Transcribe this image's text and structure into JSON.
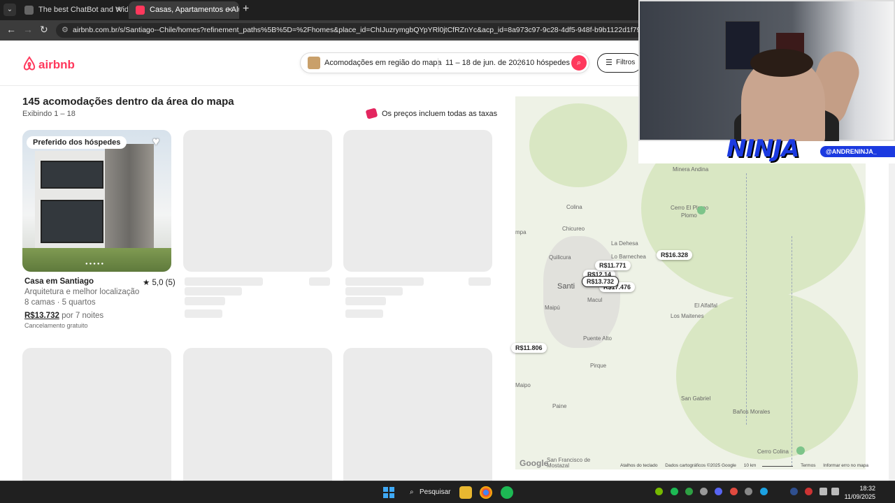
{
  "browser": {
    "tabs": [
      {
        "label": "The best ChatBot and Widgets"
      },
      {
        "label": "Casas, Apartamentos e Aluguéi"
      }
    ],
    "url": "airbnb.com.br/s/Santiago--Chile/homes?refinement_paths%5B%5D=%2Fhomes&place_id=ChIJuzrymgbQYpYRl0jtCfRZnYc&acp_id=8a973c97-9c28-4df5-948f-b9b1122d1f79&date_picker_type=cale"
  },
  "header": {
    "logo": "airbnb",
    "search_location": "Acomodações em região do mapa",
    "search_dates": "11 – 18 de jun. de 2026",
    "search_guests": "10 hóspedes",
    "filters_label": "Filtros"
  },
  "results": {
    "title": "145 acomodações dentro da área do mapa",
    "subtitle": "Exibindo 1 – 18",
    "price_note": "Os preços incluem todas as taxas"
  },
  "listing": {
    "badge": "Preferido dos hóspedes",
    "title": "Casa em Santiago",
    "rating": "★ 5,0 (5)",
    "line1": "Arquitetura e melhor localização",
    "line2": "8 camas · 5 quartos",
    "price": "R$13.732",
    "price_suffix": "por 7 noites",
    "cancel": "Cancelamento gratuito"
  },
  "map": {
    "places": {
      "minera": "Minera Andina",
      "colina": "Colina",
      "cerro_plomo": "Cerro El Plomo",
      "chicureo": "Chicureo",
      "dehesa": "La Dehesa",
      "barnechea": "Lo Barnechea",
      "quilicura": "Quilicura",
      "santiago": "Santi",
      "maipu": "Maipú",
      "macul": "Macul",
      "alfalfal": "El Alfalfal",
      "maitenes": "Los Maitenes",
      "puente_alto": "Puente Alto",
      "pirque": "Pirque",
      "paine": "Paine",
      "maipo": "Maipo",
      "san_gabriel": "San Gabriel",
      "banos": "Baños Morales",
      "cerro_colina": "Cerro Colina",
      "mostazal": "San Francisco de Mostazal",
      "pampa": "mpa"
    },
    "pins": {
      "p1": "R$16.328",
      "p2": "R$11.771",
      "p3": "R$13.732",
      "p4": "R$17.476",
      "p5": "R$11.806",
      "p6": "R$12.14"
    },
    "google": "Google",
    "footer": {
      "shortcuts": "Atalhos do teclado",
      "data": "Dados cartográficos ©2025 Google",
      "scale": "10 km",
      "terms": "Termos",
      "report": "Informar erro no mapa"
    }
  },
  "webcam": {
    "logo_text": "NINJA",
    "handle": "@ANDRENINJA_"
  },
  "taskbar": {
    "search": "Pesquisar",
    "time": "18:32",
    "date": "11/09/2025"
  }
}
